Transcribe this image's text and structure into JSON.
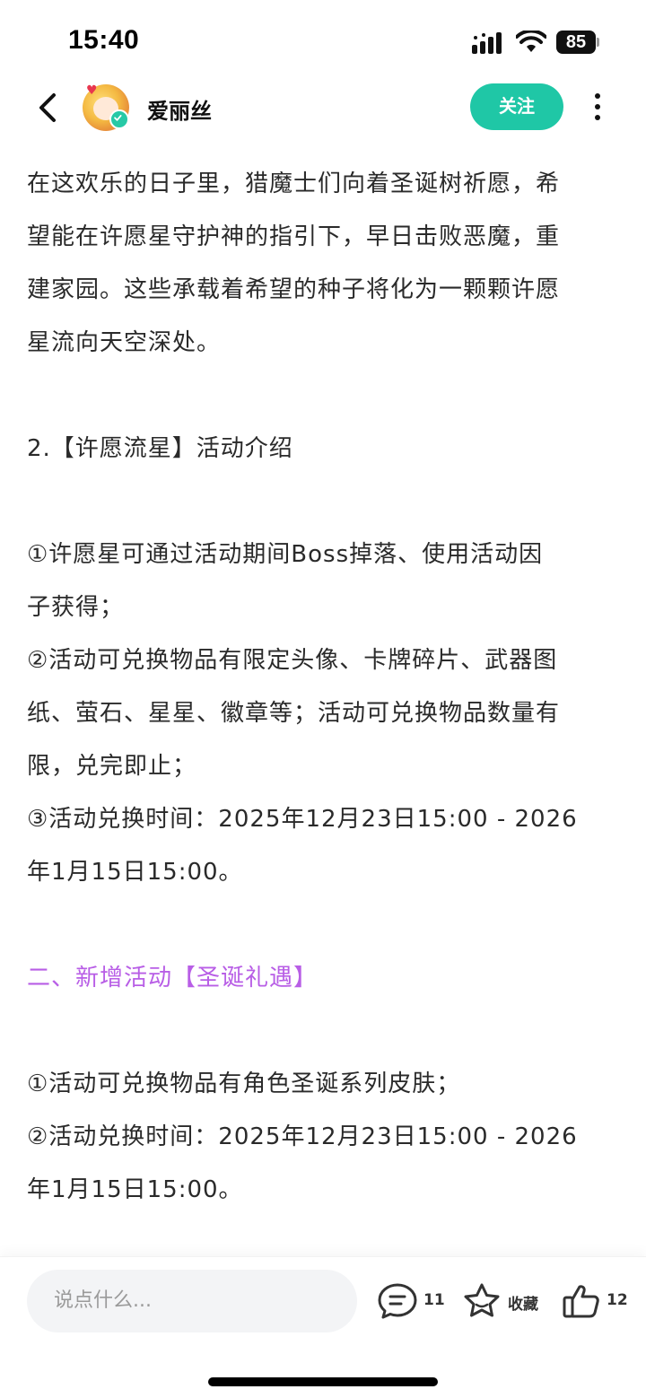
{
  "status_bar": {
    "time": "15:40",
    "battery": "85"
  },
  "header": {
    "username": "爱丽丝",
    "follow_label": "关注"
  },
  "content": {
    "paragraphs": [
      {
        "text": " 在这欢乐的日子里，猎魔士们向着圣诞树祈愿，希"
      },
      {
        "text": "望能在许愿星守护神的指引下，早日击败恶魔，重"
      },
      {
        "text": "建家园。这些承载着希望的种子将化为一颗颗许愿"
      },
      {
        "text": "星流向天空深处。"
      },
      {
        "text": "2.【许愿流星】活动介绍"
      },
      {
        "text": "①许愿星可通过活动期间Boss掉落、使用活动因"
      },
      {
        "text": "子获得；"
      },
      {
        "text": "②活动可兑换物品有限定头像、卡牌碎片、武器图"
      },
      {
        "text": "纸、萤石、星星、徽章等；活动可兑换物品数量有"
      },
      {
        "text": "限，兑完即止；"
      },
      {
        "text": "③活动兑换时间：2025年12月23日15:00 - 2026"
      },
      {
        "text": "年1月15日15:00。"
      },
      {
        "text": "二、新增活动【圣诞礼遇】",
        "color": "#b85ee6"
      },
      {
        "text": "①活动可兑换物品有角色圣诞系列皮肤；"
      },
      {
        "text": "②活动兑换时间：2025年12月23日15:00 - 2026"
      },
      {
        "text": "年1月15日15:00。"
      }
    ]
  },
  "bottom_bar": {
    "comment_placeholder": "说点什么...",
    "comment_count": "11",
    "favorite_label": "收藏",
    "like_count": "12"
  }
}
